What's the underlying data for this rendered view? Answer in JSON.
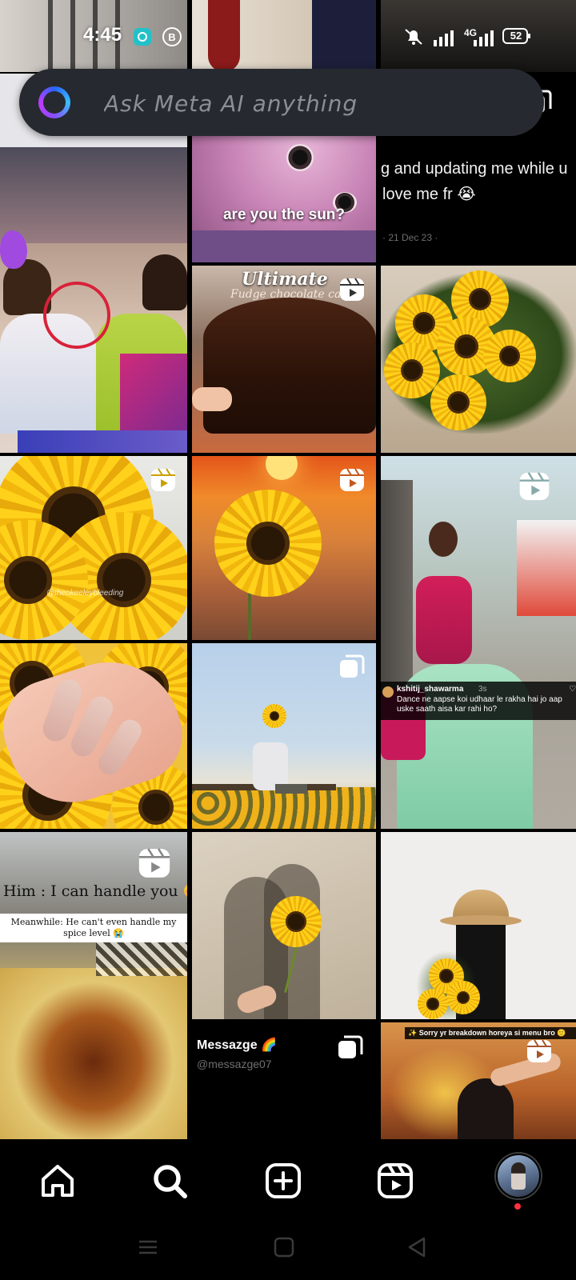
{
  "status_bar": {
    "time": "4:45",
    "battery": "52",
    "network": "4G",
    "icons": [
      "alarm-app-icon",
      "b-notification-icon",
      "mute-icon",
      "signal-icon",
      "battery-icon"
    ]
  },
  "meta_ai": {
    "placeholder": "Ask Meta AI anything"
  },
  "grid": {
    "tiles": [
      {
        "id": "drama-scene",
        "kind": "none"
      },
      {
        "id": "cat-sun",
        "kind": "none",
        "caption": "are you the sun?"
      },
      {
        "id": "tweet-post",
        "kind": "carousel",
        "line1": "g and updating me while u",
        "line2": "love me fr 😭",
        "date": "· 21 Dec 23 ·"
      },
      {
        "id": "chocolate-cake",
        "kind": "reel",
        "title": "Ultimate",
        "subtitle": "Fudge chocolate ca"
      },
      {
        "id": "sunflower-bouquet",
        "kind": "none"
      },
      {
        "id": "sunflower-closeup",
        "kind": "reel",
        "watermark": "@theokeeleybleeding"
      },
      {
        "id": "sunflower-sunset",
        "kind": "reel"
      },
      {
        "id": "dancing-woman",
        "kind": "reel",
        "comment_user": "kshitij_shawarma",
        "comment_time": "3s",
        "comment_text": "Dance ne aapse koi udhaar le rakha hai jo aap uske saath aisa kar rahi ho?"
      },
      {
        "id": "sunflower-nails",
        "kind": "none"
      },
      {
        "id": "man-with-sunflower",
        "kind": "carousel"
      },
      {
        "id": "noodles-meme",
        "kind": "reel",
        "top_text": "Him : I can handle you 🤭",
        "bottom_text": "Meanwhile: He can't even handle my spice level 😭"
      },
      {
        "id": "shadow-couple",
        "kind": "none"
      },
      {
        "id": "hat-sunflowers",
        "kind": "none"
      },
      {
        "id": "messazge",
        "kind": "carousel",
        "title": "Messazge 🌈",
        "handle": "@messazge07"
      },
      {
        "id": "breakdown-reel",
        "kind": "reel",
        "banner": "✨ Sorry yr breakdown horeya si menu bro 🙂"
      }
    ]
  },
  "bottom_nav": {
    "items": [
      {
        "name": "home",
        "icon": "home-icon"
      },
      {
        "name": "search",
        "icon": "search-icon",
        "active": true
      },
      {
        "name": "create",
        "icon": "create-icon"
      },
      {
        "name": "reels",
        "icon": "reels-icon"
      },
      {
        "name": "profile",
        "icon": "avatar"
      }
    ]
  },
  "colors": {
    "background": "#000000",
    "search_bar": "#262a30",
    "sunflower_yellow": "#ffd11a",
    "notification_red": "#ff3040"
  }
}
